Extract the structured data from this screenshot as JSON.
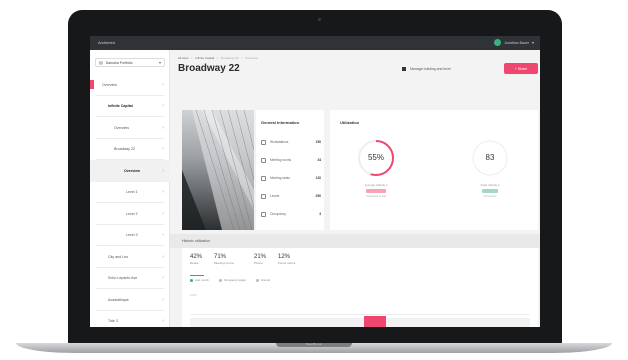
{
  "device": {
    "brand": "MacBook"
  },
  "app": {
    "name": "Archimed",
    "user_name": "Jonathan Bauer"
  },
  "sidebar": {
    "portfolio_label": "Danubia Portfolio",
    "items": [
      {
        "label": "Overview",
        "indent": 12,
        "bold": false,
        "active": false,
        "marker": true
      },
      {
        "label": "Infinite Capital",
        "indent": 18,
        "bold": true,
        "active": false,
        "marker": false
      },
      {
        "label": "Overview",
        "indent": 24,
        "bold": false,
        "active": false,
        "marker": false
      },
      {
        "label": "Broadway 22",
        "indent": 24,
        "bold": false,
        "active": false,
        "marker": false
      },
      {
        "label": "Overview",
        "indent": 34,
        "bold": true,
        "active": true,
        "marker": false
      },
      {
        "label": "Level 1",
        "indent": 36,
        "bold": false,
        "active": false,
        "marker": false
      },
      {
        "label": "Level 2",
        "indent": 36,
        "bold": false,
        "active": false,
        "marker": false
      },
      {
        "label": "Level 3",
        "indent": 36,
        "bold": false,
        "active": false,
        "marker": false
      },
      {
        "label": "City and Leo",
        "indent": 18,
        "bold": false,
        "active": false,
        "marker": false
      },
      {
        "label": "Soho Lepanto Ave",
        "indent": 18,
        "bold": false,
        "active": false,
        "marker": false
      },
      {
        "label": "Acadiathique",
        "indent": 18,
        "bold": false,
        "active": false,
        "marker": false
      },
      {
        "label": "Tide 3",
        "indent": 18,
        "bold": false,
        "active": false,
        "marker": false
      }
    ]
  },
  "breadcrumb": {
    "root": "All sites",
    "sep": "/",
    "parent": "Infinite Capital",
    "current": "Broadway 22",
    "leaf": "Overview"
  },
  "page": {
    "title": "Broadway 22",
    "edit_label": "Manage building and level",
    "share_label": "+ Share"
  },
  "general_info": {
    "title": "General Information",
    "rows": [
      {
        "label": "Workstations",
        "value": "150"
      },
      {
        "label": "Meeting rooms",
        "value": "24"
      },
      {
        "label": "Meeting seats",
        "value": "120"
      },
      {
        "label": "Levels",
        "value": "250"
      },
      {
        "label": "Occupancy",
        "value": "3"
      }
    ]
  },
  "utilization": {
    "title": "Utilization",
    "gauge": {
      "value": "55%",
      "percent": 55,
      "caption": "Average utilization",
      "pill_caption": "Compared to last"
    },
    "secondary": {
      "value": "83",
      "caption": "Peak utilization",
      "pill_caption": "Occupancy"
    }
  },
  "historic": {
    "title": "Historic utilization"
  },
  "stats": [
    {
      "value": "42%",
      "label": "Desks"
    },
    {
      "value": "71%",
      "label": "Meeting rooms"
    },
    {
      "value": "21%",
      "label": "Phone"
    },
    {
      "value": "12%",
      "label": "Focus rooms"
    }
  ],
  "legend": [
    "Last month",
    "Occupancy target",
    "Interval"
  ],
  "chart_axis_label": "100%",
  "colors": {
    "accent": "#ef476f",
    "success": "#36b37e",
    "topbar": "#2f3236"
  }
}
